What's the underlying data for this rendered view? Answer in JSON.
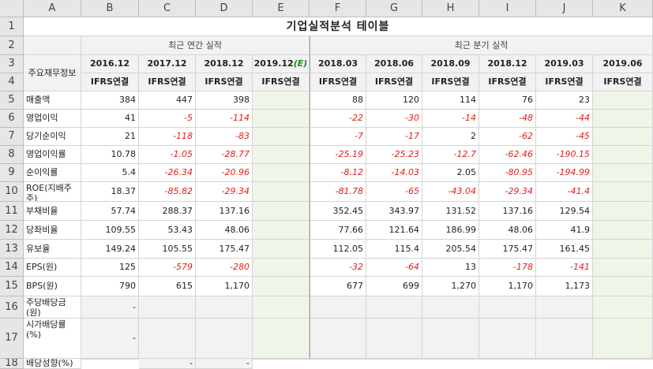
{
  "columns": [
    "A",
    "B",
    "C",
    "D",
    "E",
    "F",
    "G",
    "H",
    "I",
    "J",
    "K"
  ],
  "row_numbers": [
    "1",
    "2",
    "3",
    "4",
    "5",
    "6",
    "7",
    "8",
    "9",
    "10",
    "11",
    "12",
    "13",
    "14",
    "15",
    "16",
    "17",
    "18"
  ],
  "title": "기업실적분석 테이블",
  "group_annual": "최근 연간 실적",
  "group_quarter": "최근 분기 실적",
  "row_header_label": "주요재무정보",
  "periods": [
    "2016.12",
    "2017.12",
    "2018.12",
    "2019.12",
    "2018.03",
    "2018.06",
    "2018.09",
    "2018.12",
    "2019.03",
    "2019.06"
  ],
  "estimate_flag": "(E)",
  "standard": "IFRS연결",
  "rows": [
    {
      "label": "매출액",
      "values": [
        "384",
        "447",
        "398",
        "",
        "88",
        "120",
        "114",
        "76",
        "23",
        ""
      ]
    },
    {
      "label": "영업이익",
      "values": [
        "41",
        "-5",
        "-114",
        "",
        "-22",
        "-30",
        "-14",
        "-48",
        "-44",
        ""
      ]
    },
    {
      "label": "당기순이익",
      "values": [
        "21",
        "-118",
        "-83",
        "",
        "-7",
        "-17",
        "2",
        "-62",
        "-45",
        ""
      ]
    },
    {
      "label": "영업이익률",
      "values": [
        "10.78",
        "-1.05",
        "-28.77",
        "",
        "-25.19",
        "-25.23",
        "-12.7",
        "-62.46",
        "-190.15",
        ""
      ]
    },
    {
      "label": "순이익률",
      "values": [
        "5.4",
        "-26.34",
        "-20.96",
        "",
        "-8.12",
        "-14.03",
        "2.05",
        "-80.95",
        "-194.99",
        ""
      ]
    },
    {
      "label": "ROE(지배주주)",
      "values": [
        "18.37",
        "-85.82",
        "-29.34",
        "",
        "-81.78",
        "-65",
        "-43.04",
        "-29.34",
        "-41.4",
        ""
      ]
    },
    {
      "label": "부채비율",
      "values": [
        "57.74",
        "288.37",
        "137.16",
        "",
        "352.45",
        "343.97",
        "131.52",
        "137.16",
        "129.54",
        ""
      ]
    },
    {
      "label": "당좌비율",
      "values": [
        "109.55",
        "53.43",
        "48.06",
        "",
        "77.66",
        "121.64",
        "186.99",
        "48.06",
        "41.9",
        ""
      ]
    },
    {
      "label": "유보율",
      "values": [
        "149.24",
        "105.55",
        "175.47",
        "",
        "112.05",
        "115.4",
        "205.54",
        "175.47",
        "161.45",
        ""
      ]
    },
    {
      "label": "EPS(원)",
      "values": [
        "125",
        "-579",
        "-280",
        "",
        "-32",
        "-64",
        "13",
        "-178",
        "-141",
        ""
      ]
    },
    {
      "label": "BPS(원)",
      "values": [
        "790",
        "615",
        "1,170",
        "",
        "677",
        "699",
        "1,270",
        "1,170",
        "1,173",
        ""
      ]
    },
    {
      "label": "주당배당금(원)",
      "values": [
        "-",
        "",
        "",
        "",
        "",
        "",
        "",
        "",
        "",
        ""
      ]
    },
    {
      "label": "시가배당률(%)",
      "values": [
        "-",
        "",
        "",
        "",
        "",
        "",
        "",
        "",
        "",
        ""
      ]
    },
    {
      "label": "배당성향(%)",
      "values": [
        "",
        "-",
        "-",
        "",
        "",
        "",
        "",
        "",
        "",
        ""
      ]
    }
  ],
  "colors": {
    "negative": "#e0201c",
    "estimate": "#1a8a1a",
    "header_bg": "#e6e6e6",
    "estimate_bg": "#eef6ea"
  }
}
